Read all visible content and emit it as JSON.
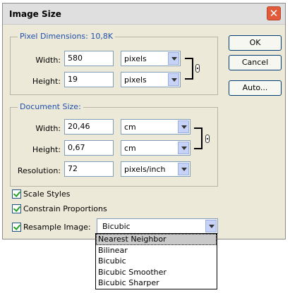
{
  "window": {
    "title": "Image Size",
    "close": "✕"
  },
  "pixel_dimensions": {
    "title": "Pixel Dimensions:",
    "size": "10,8K",
    "width_label": "Width:",
    "width_value": "580",
    "width_unit": "pixels",
    "height_label": "Height:",
    "height_value": "19",
    "height_unit": "pixels"
  },
  "document_size": {
    "title": "Document Size:",
    "width_label": "Width:",
    "width_value": "20,46",
    "width_unit": "cm",
    "height_label": "Height:",
    "height_value": "0,67",
    "height_unit": "cm",
    "resolution_label": "Resolution:",
    "resolution_value": "72",
    "resolution_unit": "pixels/inch"
  },
  "buttons": {
    "ok": "OK",
    "cancel": "Cancel",
    "auto": "Auto..."
  },
  "options": {
    "scale_styles": "Scale Styles",
    "constrain_proportions": "Constrain Proportions",
    "resample_label": "Resample Image:",
    "resample_value": "Bicubic"
  },
  "resample_menu": {
    "items": [
      "Nearest Neighbor",
      "Bilinear",
      "Bicubic",
      "Bicubic Smoother",
      "Bicubic Sharper"
    ],
    "highlighted": "Nearest Neighbor"
  },
  "colors": {
    "accent": "#1f4fb0",
    "highlight": "#c9c9c9",
    "dialog_bg": "#ece9d8"
  }
}
